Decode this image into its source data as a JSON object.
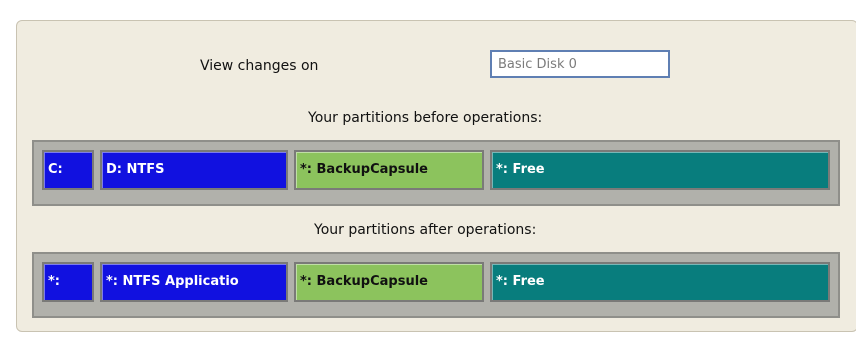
{
  "view_changes": {
    "label": "View changes on",
    "disk_value": "Basic Disk 0"
  },
  "before": {
    "heading": "Your partitions before operations:",
    "partitions": [
      {
        "label": "C:",
        "color": "#1111e0"
      },
      {
        "label": "D: NTFS",
        "color": "#1111e0"
      },
      {
        "label": "*: BackupCapsule",
        "color": "#8cc35d"
      },
      {
        "label": "*: Free",
        "color": "#087d7d"
      }
    ]
  },
  "after": {
    "heading": "Your partitions after operations:",
    "partitions": [
      {
        "label": "*:",
        "color": "#1111e0"
      },
      {
        "label": "*: NTFS Applicatio",
        "color": "#1111e0"
      },
      {
        "label": "*: BackupCapsule",
        "color": "#8cc35d"
      },
      {
        "label": "*: Free",
        "color": "#087d7d"
      }
    ]
  }
}
